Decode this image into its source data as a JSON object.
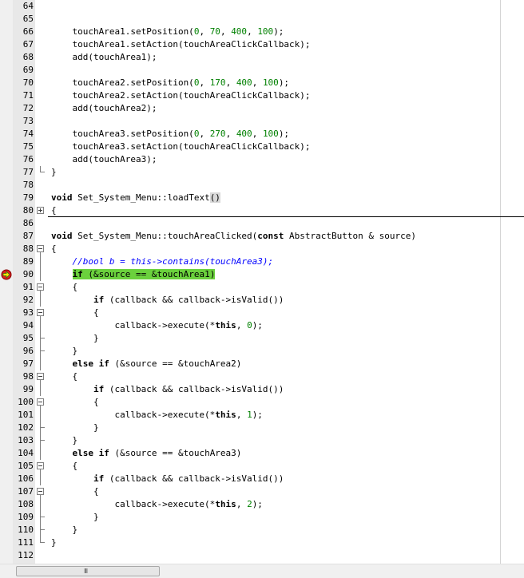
{
  "editor": {
    "lines": [
      {
        "n": "64",
        "t": []
      },
      {
        "n": "65",
        "t": []
      },
      {
        "n": "66",
        "t": [
          [
            "",
            "    touchArea1.setPosition("
          ],
          [
            "num",
            "0"
          ],
          [
            "",
            ", "
          ],
          [
            "num",
            "70"
          ],
          [
            "",
            ", "
          ],
          [
            "num",
            "400"
          ],
          [
            "",
            ", "
          ],
          [
            "num",
            "100"
          ],
          [
            "",
            ");"
          ]
        ]
      },
      {
        "n": "67",
        "t": [
          [
            "",
            "    touchArea1.setAction(touchAreaClickCallback);"
          ]
        ]
      },
      {
        "n": "68",
        "t": [
          [
            "",
            "    add(touchArea1);"
          ]
        ]
      },
      {
        "n": "69",
        "t": []
      },
      {
        "n": "70",
        "t": [
          [
            "",
            "    touchArea2.setPosition("
          ],
          [
            "num",
            "0"
          ],
          [
            "",
            ", "
          ],
          [
            "num",
            "170"
          ],
          [
            "",
            ", "
          ],
          [
            "num",
            "400"
          ],
          [
            "",
            ", "
          ],
          [
            "num",
            "100"
          ],
          [
            "",
            ");"
          ]
        ]
      },
      {
        "n": "71",
        "t": [
          [
            "",
            "    touchArea2.setAction(touchAreaClickCallback);"
          ]
        ]
      },
      {
        "n": "72",
        "t": [
          [
            "",
            "    add(touchArea2);"
          ]
        ]
      },
      {
        "n": "73",
        "t": []
      },
      {
        "n": "74",
        "t": [
          [
            "",
            "    touchArea3.setPosition("
          ],
          [
            "num",
            "0"
          ],
          [
            "",
            ", "
          ],
          [
            "num",
            "270"
          ],
          [
            "",
            ", "
          ],
          [
            "num",
            "400"
          ],
          [
            "",
            ", "
          ],
          [
            "num",
            "100"
          ],
          [
            "",
            ");"
          ]
        ]
      },
      {
        "n": "75",
        "t": [
          [
            "",
            "    touchArea3.setAction(touchAreaClickCallback);"
          ]
        ]
      },
      {
        "n": "76",
        "t": [
          [
            "",
            "    add(touchArea3);"
          ]
        ]
      },
      {
        "n": "77",
        "t": [
          [
            "",
            "}"
          ]
        ],
        "fold": "end"
      },
      {
        "n": "78",
        "t": []
      },
      {
        "n": "79",
        "t": [
          [
            "kw",
            "void"
          ],
          [
            "",
            " Set_System_Menu::loadText"
          ],
          [
            "paren-match",
            "()"
          ]
        ]
      },
      {
        "n": "80",
        "t": [
          [
            "",
            "{"
          ]
        ],
        "fold": "plus",
        "sep": true
      },
      {
        "n": "86",
        "t": []
      },
      {
        "n": "87",
        "t": [
          [
            "kw",
            "void"
          ],
          [
            "",
            " Set_System_Menu::touchAreaClicked("
          ],
          [
            "kw",
            "const"
          ],
          [
            "",
            " AbstractButton & source)"
          ]
        ]
      },
      {
        "n": "88",
        "t": [
          [
            "",
            "{"
          ]
        ],
        "fold": "minus"
      },
      {
        "n": "89",
        "t": [
          [
            "",
            "    "
          ],
          [
            "cmt",
            "//bool b = this->contains(touchArea3);"
          ]
        ],
        "fold": "line"
      },
      {
        "n": "90",
        "t": [
          [
            "",
            "    "
          ],
          [
            "hl-kw",
            "if"
          ],
          [
            "hl",
            " (&source == &touchArea1)"
          ]
        ],
        "fold": "line",
        "bp": true
      },
      {
        "n": "91",
        "t": [
          [
            "",
            "    {"
          ]
        ],
        "fold": "minus"
      },
      {
        "n": "92",
        "t": [
          [
            "",
            "        "
          ],
          [
            "kw",
            "if"
          ],
          [
            "",
            " (callback && callback->isValid())"
          ]
        ],
        "fold": "line"
      },
      {
        "n": "93",
        "t": [
          [
            "",
            "        {"
          ]
        ],
        "fold": "minus"
      },
      {
        "n": "94",
        "t": [
          [
            "",
            "            callback->execute(*"
          ],
          [
            "kw",
            "this"
          ],
          [
            "",
            ", "
          ],
          [
            "num",
            "0"
          ],
          [
            "",
            ");"
          ]
        ],
        "fold": "line"
      },
      {
        "n": "95",
        "t": [
          [
            "",
            "        }"
          ]
        ],
        "fold": "end"
      },
      {
        "n": "96",
        "t": [
          [
            "",
            "    }"
          ]
        ],
        "fold": "end"
      },
      {
        "n": "97",
        "t": [
          [
            "",
            "    "
          ],
          [
            "kw",
            "else if"
          ],
          [
            "",
            " (&source == &touchArea2)"
          ]
        ],
        "fold": "line"
      },
      {
        "n": "98",
        "t": [
          [
            "",
            "    {"
          ]
        ],
        "fold": "minus"
      },
      {
        "n": "99",
        "t": [
          [
            "",
            "        "
          ],
          [
            "kw",
            "if"
          ],
          [
            "",
            " (callback && callback->isValid())"
          ]
        ],
        "fold": "line"
      },
      {
        "n": "100",
        "t": [
          [
            "",
            "        {"
          ]
        ],
        "fold": "minus"
      },
      {
        "n": "101",
        "t": [
          [
            "",
            "            callback->execute(*"
          ],
          [
            "kw",
            "this"
          ],
          [
            "",
            ", "
          ],
          [
            "num",
            "1"
          ],
          [
            "",
            ");"
          ]
        ],
        "fold": "line"
      },
      {
        "n": "102",
        "t": [
          [
            "",
            "        }"
          ]
        ],
        "fold": "end"
      },
      {
        "n": "103",
        "t": [
          [
            "",
            "    }"
          ]
        ],
        "fold": "end"
      },
      {
        "n": "104",
        "t": [
          [
            "",
            "    "
          ],
          [
            "kw",
            "else if"
          ],
          [
            "",
            " (&source == &touchArea3)"
          ]
        ],
        "fold": "line"
      },
      {
        "n": "105",
        "t": [
          [
            "",
            "    {"
          ]
        ],
        "fold": "minus"
      },
      {
        "n": "106",
        "t": [
          [
            "",
            "        "
          ],
          [
            "kw",
            "if"
          ],
          [
            "",
            " (callback && callback->isValid())"
          ]
        ],
        "fold": "line"
      },
      {
        "n": "107",
        "t": [
          [
            "",
            "        {"
          ]
        ],
        "fold": "minus"
      },
      {
        "n": "108",
        "t": [
          [
            "",
            "            callback->execute(*"
          ],
          [
            "kw",
            "this"
          ],
          [
            "",
            ", "
          ],
          [
            "num",
            "2"
          ],
          [
            "",
            ");"
          ]
        ],
        "fold": "line"
      },
      {
        "n": "109",
        "t": [
          [
            "",
            "        }"
          ]
        ],
        "fold": "end"
      },
      {
        "n": "110",
        "t": [
          [
            "",
            "    }"
          ]
        ],
        "fold": "end"
      },
      {
        "n": "111",
        "t": [
          [
            "",
            "}"
          ]
        ],
        "fold": "end"
      },
      {
        "n": "112",
        "t": []
      }
    ],
    "breakpoint_icon": "breakpoint-arrow-icon",
    "colors": {
      "keyword": "#000000",
      "number": "#008000",
      "comment": "#0000ff",
      "current_line_highlight": "#6bd13d",
      "breakpoint": "#e02020"
    }
  },
  "scrollbar": {
    "grip_icon": "scroll-grip-icon",
    "grip_text": "III"
  }
}
